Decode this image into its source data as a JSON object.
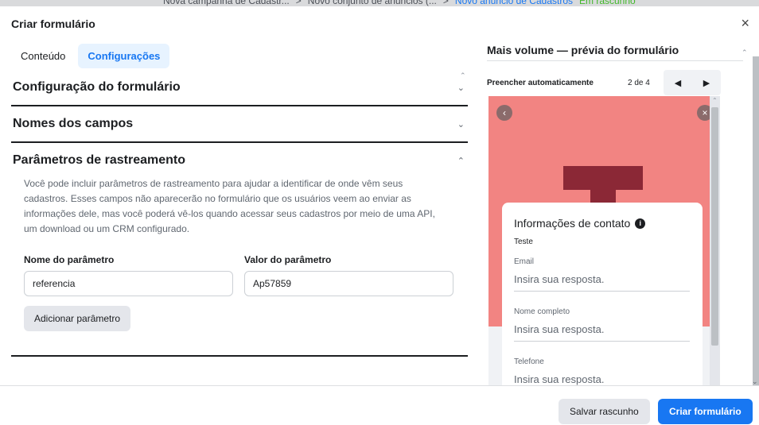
{
  "background_bar": {
    "campaign": "Nova campanha de Cadastr...",
    "adset": "Novo conjunto de anúncios (...",
    "ad": "Novo anúncio de Cadastros",
    "status": "Em rascunho"
  },
  "modal": {
    "title": "Criar formulário",
    "close_icon": "×"
  },
  "tabs": [
    {
      "label": "Conteúdo",
      "active": false
    },
    {
      "label": "Configurações",
      "active": true
    }
  ],
  "sections": {
    "config": {
      "title": "Configuração do formulário",
      "chevron": "⌄"
    },
    "field_names": {
      "title": "Nomes dos campos",
      "chevron": "⌄"
    },
    "tracking": {
      "title": "Parâmetros de rastreamento",
      "chevron": "⌃",
      "description": "Você pode incluir parâmetros de rastreamento para ajudar a identificar de onde vêm seus cadastros. Esses campos não aparecerão no formulário que os usuários veem ao enviar as informações dele, mas você poderá vê-los quando acessar seus cadastros por meio de uma API, um download ou um CRM configurado.",
      "param_name_label": "Nome do parâmetro",
      "param_name_value": "referencia",
      "param_value_label": "Valor do parâmetro",
      "param_value_value": "Ap57859",
      "add_button": "Adicionar parâmetro"
    }
  },
  "preview": {
    "title": "Mais volume — prévia do formulário",
    "autofill": "Preencher automaticamente",
    "page": "2 de 4",
    "prev_icon": "◀",
    "next_icon": "▶",
    "card_title": "Informações de contato",
    "info_icon": "i",
    "subtitle": "Teste",
    "fields": [
      {
        "label": "Email",
        "placeholder": "Insira sua resposta."
      },
      {
        "label": "Nome completo",
        "placeholder": "Insira sua resposta."
      },
      {
        "label": "Telefone",
        "placeholder": "Insira sua resposta."
      }
    ]
  },
  "footer": {
    "save_draft": "Salvar rascunho",
    "create_form": "Criar formulário"
  },
  "colors": {
    "accent": "#1877f2",
    "preview_bg": "#f28482",
    "preview_mark": "#8b2836"
  }
}
